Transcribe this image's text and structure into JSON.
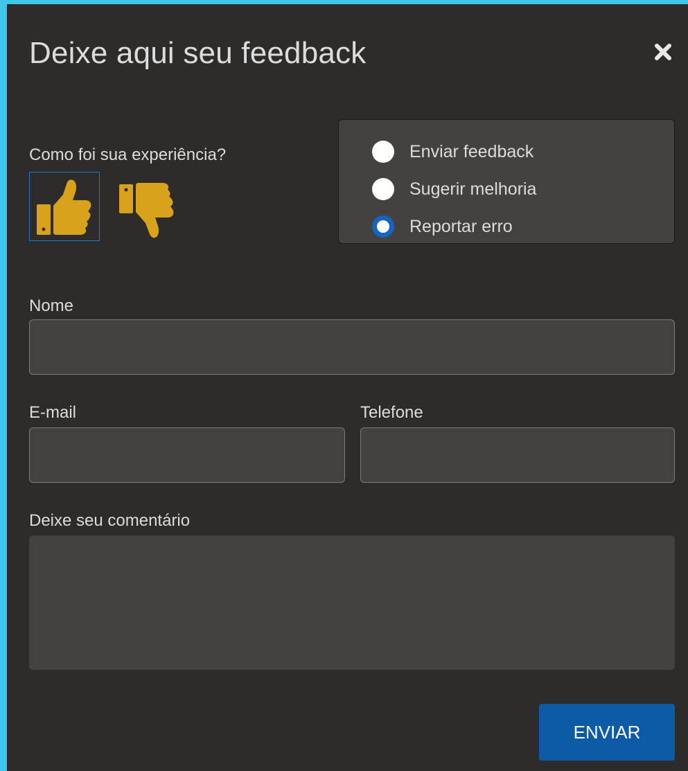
{
  "modal": {
    "title": "Deixe aqui seu feedback",
    "close_icon": "close-icon"
  },
  "experience": {
    "label": "Como foi sua experiência?",
    "like_icon": "thumbs-up-icon",
    "dislike_icon": "thumbs-down-icon",
    "selected": "like",
    "icon_color": "#d9a21b",
    "selected_border_color": "#1f78d1"
  },
  "feedback_type": {
    "options": [
      {
        "label": "Enviar feedback",
        "checked": false
      },
      {
        "label": "Sugerir melhoria",
        "checked": false
      },
      {
        "label": "Reportar erro",
        "checked": true
      }
    ],
    "checked_color": "#1565c0"
  },
  "form": {
    "name": {
      "label": "Nome",
      "value": ""
    },
    "email": {
      "label": "E-mail",
      "value": ""
    },
    "phone": {
      "label": "Telefone",
      "value": ""
    },
    "comment": {
      "label": "Deixe seu comentário",
      "value": ""
    }
  },
  "submit": {
    "label": "ENVIAR",
    "color": "#0d5ba6"
  },
  "theme": {
    "background": "#2d2c2b",
    "border_accent": "#3fc7ea",
    "field_background": "#434241"
  }
}
